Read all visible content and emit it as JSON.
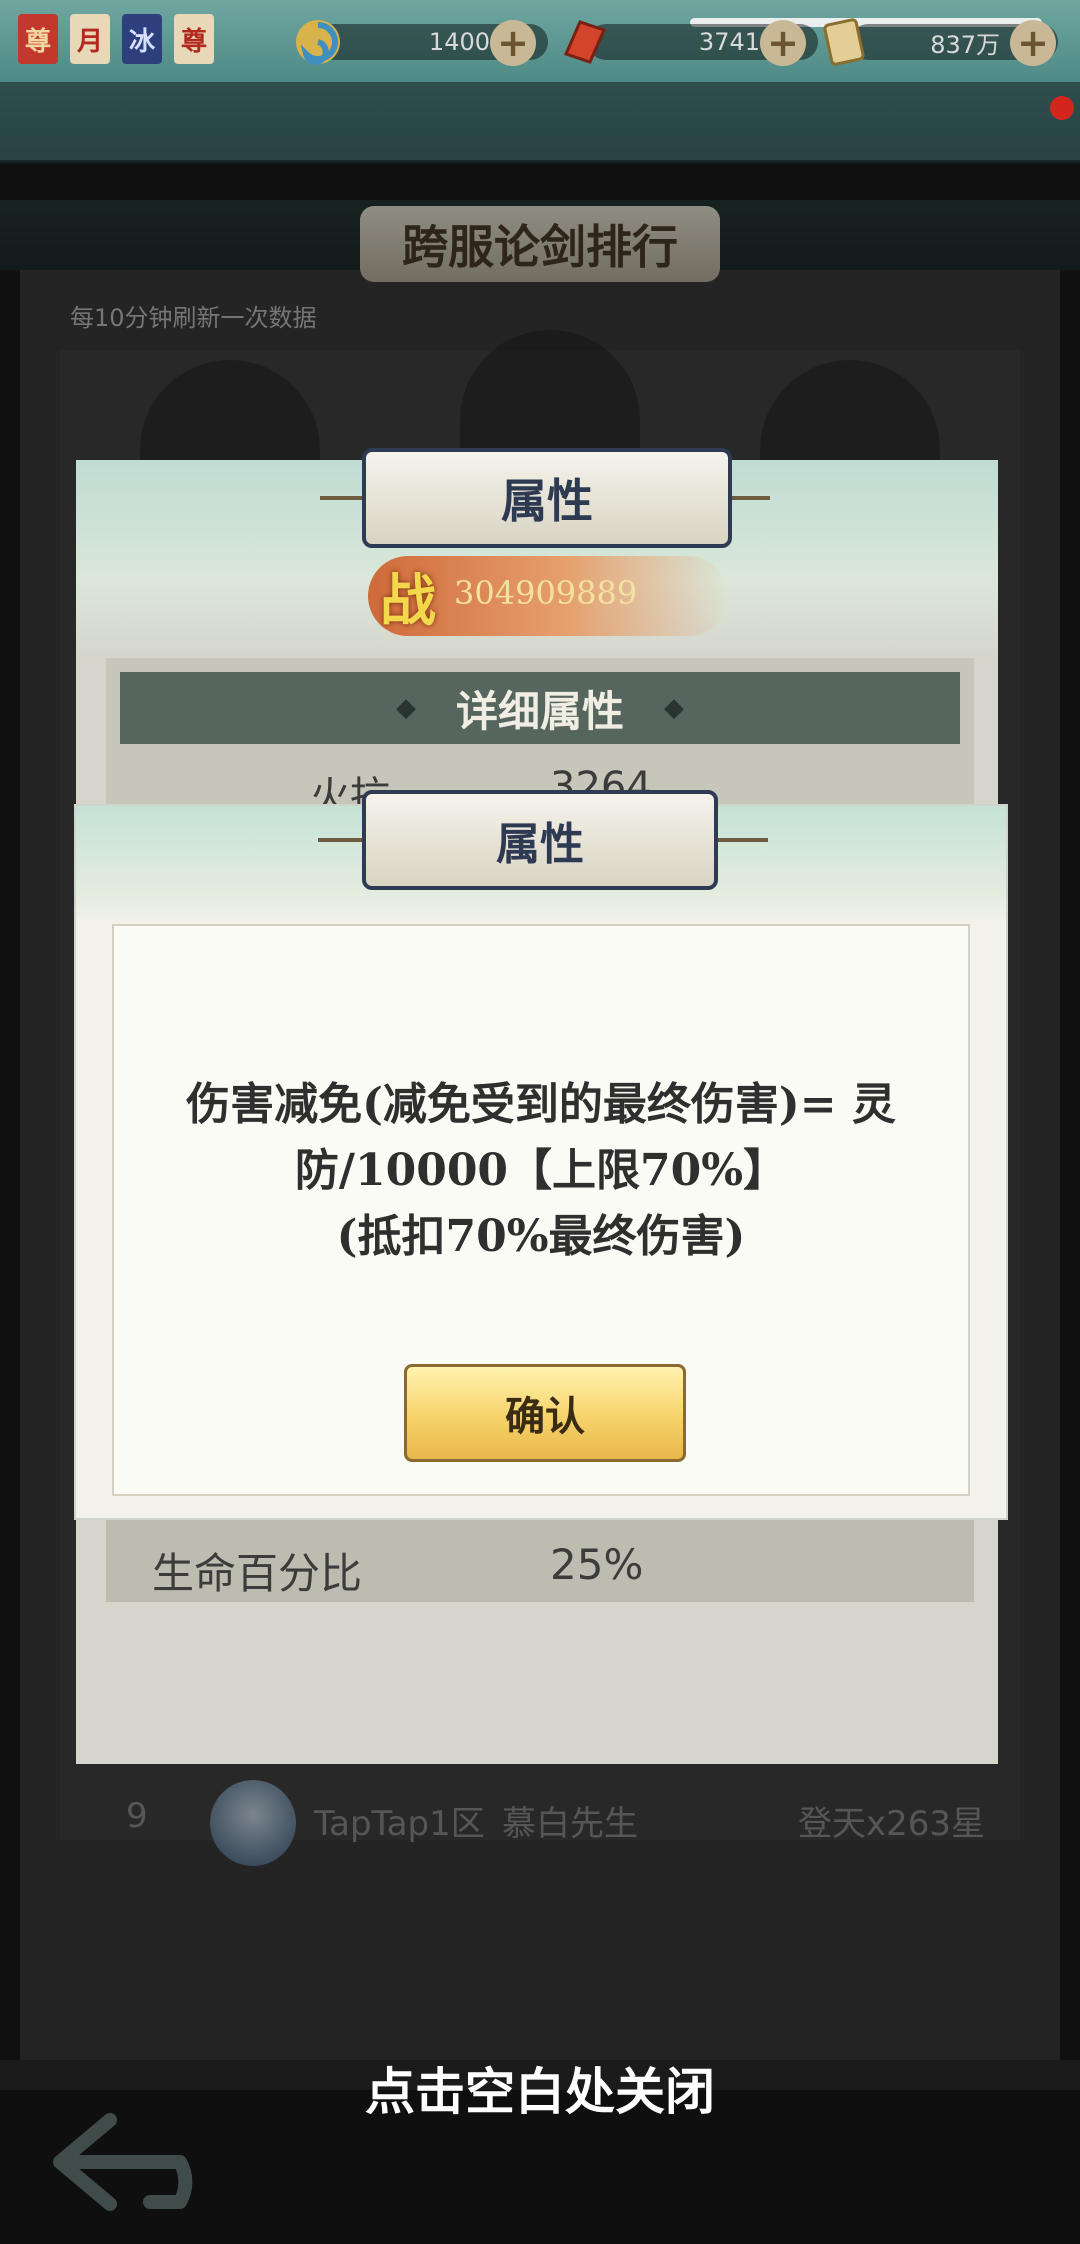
{
  "resources": {
    "badges": [
      "尊",
      "月",
      "冰",
      "尊"
    ],
    "jade_value": "1400",
    "ingot_value": "3741",
    "coin_value": "837万"
  },
  "ranking": {
    "title": "跨服论剑排行",
    "subtitle": "每10分钟刷新一次数据",
    "row": {
      "rank": "9",
      "server": "TapTap1区",
      "player": "慕白先生",
      "score": "登天x263星"
    }
  },
  "attribute_panel": {
    "title": "属性",
    "power_char": "战",
    "power_value": "304909889",
    "detail_title": "详细属性",
    "partial_row": {
      "name": "火抗",
      "value": "3264"
    },
    "bottom_row": {
      "name": "生命百分比",
      "value": "25%"
    }
  },
  "popup": {
    "title": "属性",
    "message_lines": [
      "伤害减免(减免受到的最终伤害)= 灵",
      "防/10000【上限70%】",
      "(抵扣70%最终伤害)"
    ],
    "confirm_label": "确认"
  },
  "close_hint": "点击空白处关闭",
  "colors": {
    "ribbon_border": "#2e3b53",
    "confirm_gold": "#f6d36a",
    "notify_red": "#d2261c"
  }
}
